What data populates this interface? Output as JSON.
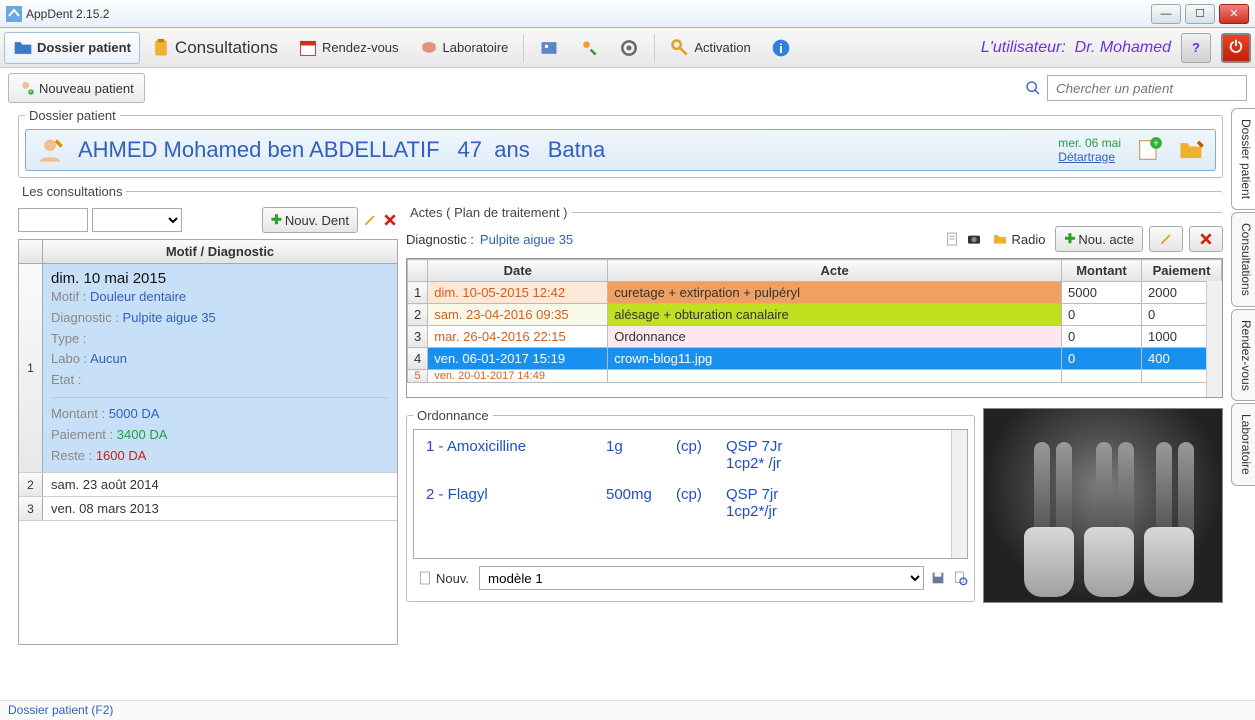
{
  "window": {
    "title": "AppDent 2.15.2"
  },
  "toolbar": {
    "dossier": "Dossier patient",
    "consult": "Consultations",
    "rdv": "Rendez-vous",
    "labo": "Laboratoire",
    "activation": "Activation",
    "user_label": "L'utilisateur:",
    "user_name": "Dr. Mohamed"
  },
  "subbar": {
    "new_patient": "Nouveau patient",
    "search_placeholder": "Chercher un patient"
  },
  "dossier": {
    "legend": "Dossier patient",
    "patient_name": "AHMED Mohamed ben ABDELLATIF",
    "age_num": "47",
    "age_unit": "ans",
    "city": "Batna",
    "next_date": "mer. 06 mai",
    "next_action": "Détartrage"
  },
  "consultations": {
    "legend": "Les consultations",
    "new_dent": "Nouv. Dent",
    "header": "Motif / Diagnostic",
    "rows": [
      {
        "date": "dim. 10 mai 2015",
        "selected": true,
        "motif_label": "Motif :",
        "motif": "Douleur dentaire",
        "diag_label": "Diagnostic :",
        "diag": "Pulpite aigue 35",
        "type_label": "Type :",
        "type": "",
        "labo_label": "Labo :",
        "labo": "Aucun",
        "etat_label": "Etat :",
        "etat": "",
        "montant_label": "Montant :",
        "montant": "5000 DA",
        "paiement_label": "Paiement :",
        "paiement": "3400 DA",
        "reste_label": "Reste :",
        "reste": "1600 DA"
      },
      {
        "date": "sam. 23 août 2014"
      },
      {
        "date": "ven. 08 mars 2013"
      }
    ]
  },
  "actes": {
    "legend": "Actes  ( Plan de traitement )",
    "diag_label": "Diagnostic :",
    "diag_value": "Pulpite aigue 35",
    "radio_btn": "Radio",
    "new_acte": "Nou. acte",
    "cols": {
      "date": "Date",
      "acte": "Acte",
      "montant": "Montant",
      "paiement": "Paiement"
    },
    "rows": [
      {
        "n": "1",
        "date": "dim. 10-05-2015 12:42",
        "acte": "curetage + extirpation + pulpéryl",
        "montant": "5000",
        "paiement": "2000",
        "cls": "row-orange"
      },
      {
        "n": "2",
        "date": "sam. 23-04-2016 09:35",
        "acte": "alésage + obturation canalaire",
        "montant": "0",
        "paiement": "0",
        "cls": "row-green"
      },
      {
        "n": "3",
        "date": "mar. 26-04-2016 22:15",
        "acte": "Ordonnance",
        "montant": "0",
        "paiement": "1000",
        "cls": "row-pink"
      },
      {
        "n": "4",
        "date": "ven. 06-01-2017 15:19",
        "acte": "crown-blog11.jpg",
        "montant": "0",
        "paiement": "400",
        "cls": "row-blue"
      },
      {
        "n": "5",
        "date": "ven. 20-01-2017 14:49",
        "acte": "",
        "montant": "",
        "paiement": "",
        "cls": "row-cut"
      }
    ]
  },
  "ordonnance": {
    "legend": "Ordonnance",
    "lines": [
      {
        "name": "1 - Amoxicilline",
        "dose": "1g",
        "form": "(cp)",
        "dur": "QSP 7Jr",
        "posol": "1cp2* /jr"
      },
      {
        "name": "2 - Flagyl",
        "dose": "500mg",
        "form": "(cp)",
        "dur": "QSP 7jr",
        "posol": "1cp2*/jr"
      }
    ],
    "new_btn": "Nouv.",
    "model_selected": "modèle 1"
  },
  "sidetabs": [
    "Dossier patient",
    "Consultations",
    "Rendez-vous",
    "Laboratoire"
  ],
  "status": "Dossier patient (F2)"
}
